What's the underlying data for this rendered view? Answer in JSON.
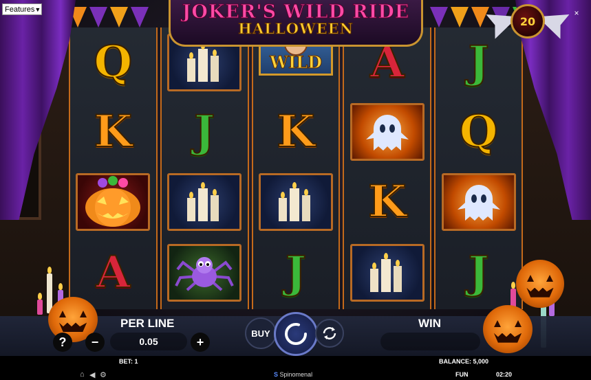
{
  "menu": {
    "features_label": "Features",
    "close_symbol": "×"
  },
  "logo": {
    "title_line1": "JOKER'S WILD RIDE",
    "title_line2": "HALLOWEEN"
  },
  "badge": {
    "value": "20"
  },
  "reels": [
    [
      "Q",
      "K",
      "pumpkin-symbol",
      "A"
    ],
    [
      "candles-symbol",
      "J",
      "candles-symbol",
      "spider-symbol"
    ],
    [
      "wild-symbol",
      "K",
      "candles-symbol",
      "J"
    ],
    [
      "A",
      "ghost-symbol",
      "K",
      "candles-symbol"
    ],
    [
      "J",
      "Q",
      "ghost-symbol",
      "J"
    ]
  ],
  "wild_label": "WILD",
  "controls": {
    "per_line_label": "PER LINE",
    "per_line_value": "0.05",
    "help_symbol": "?",
    "minus_symbol": "−",
    "plus_symbol": "+",
    "buy_label": "BUY",
    "win_label": "WIN",
    "win_value": ""
  },
  "footer": {
    "bet_label": "BET: 1",
    "balance_label": "BALANCE: 5,000",
    "provider": "Spinomenal",
    "mode": "FUN",
    "time": "02:20"
  },
  "colors": {
    "reel_border": "#c56a1a",
    "accent_gold": "#ffd23a",
    "logo_pink": "#ff4aa6",
    "curtain_purple": "#6a22a6"
  }
}
